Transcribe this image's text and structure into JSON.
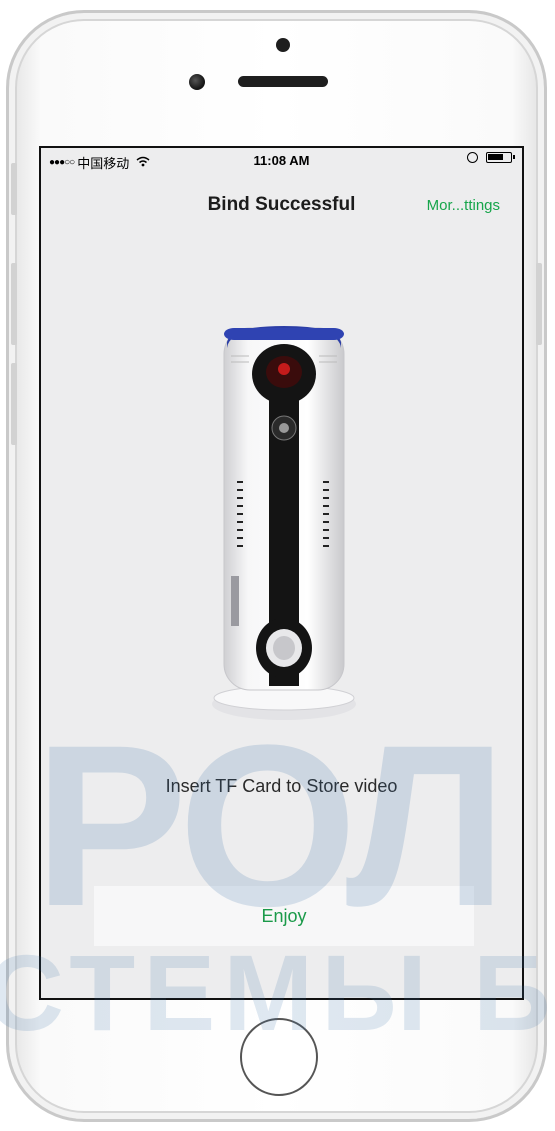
{
  "status_bar": {
    "carrier": "中国移动",
    "time": "11:08 AM"
  },
  "nav": {
    "title": "Bind Successful",
    "more_settings": "Mor...ttings"
  },
  "content": {
    "caption": "Insert TF Card to Store video",
    "enjoy_label": "Enjoy"
  },
  "watermark": {
    "line1": "РОЛ",
    "line2": "СТЕМЫ  БІ"
  },
  "colors": {
    "accent_green": "#17a54b",
    "screen_bg": "#ededee",
    "watermark_blue": "#3a6ea5"
  },
  "icons": [
    "signal-dots-icon",
    "wifi-icon",
    "lock-rotation-icon",
    "battery-icon",
    "home-button-icon"
  ]
}
